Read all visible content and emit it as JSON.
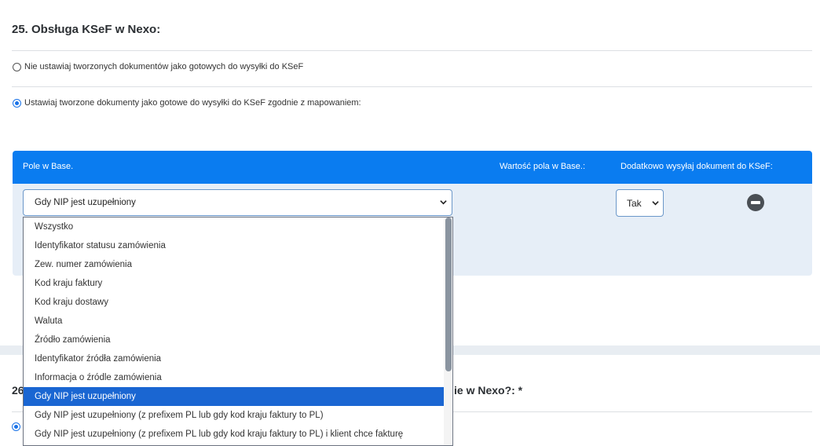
{
  "section": {
    "title": "25. Obsługa KSeF w Nexo:",
    "options": [
      {
        "label": "Nie ustawiaj tworzonych dokumentów jako gotowych do wysyłki do KSeF",
        "checked": false
      },
      {
        "label": "Ustawiaj tworzone dokumenty jako gotowe do wysyłki do KSeF zgodnie z mapowaniem:",
        "checked": true
      }
    ]
  },
  "table": {
    "headers": {
      "field": "Pole w Base.",
      "value": "Wartość pola w Base.:",
      "extra": "Dodatkowo wysyłaj dokument do KSeF:"
    },
    "row": {
      "field_select": "Gdy NIP jest uzupełniony",
      "send_select": "Tak"
    }
  },
  "dropdown": {
    "options": [
      "Wszystko",
      "Identyfikator statusu zamówienia",
      "Zew. numer zamówienia",
      "Kod kraju faktury",
      "Kod kraju dostawy",
      "Waluta",
      "Źródło zamówienia",
      "Identyfikator źródła zamówienia",
      "Informacja o źródle zamówienia",
      "Gdy NIP jest uzupełniony",
      "Gdy NIP jest uzupełniony (z prefixem PL lub gdy kod kraju faktury to PL)",
      "Gdy NIP jest uzupełniony (z prefixem PL lub gdy kod kraju faktury to PL) i klient chce fakturę"
    ],
    "selected_index": 9
  },
  "next_section": {
    "title_start": "26",
    "title_end": "ie w Nexo?: *"
  },
  "colors": {
    "accent": "#0a7cf0",
    "selected_option": "#1a66d2",
    "table_body": "#e6eef7"
  }
}
